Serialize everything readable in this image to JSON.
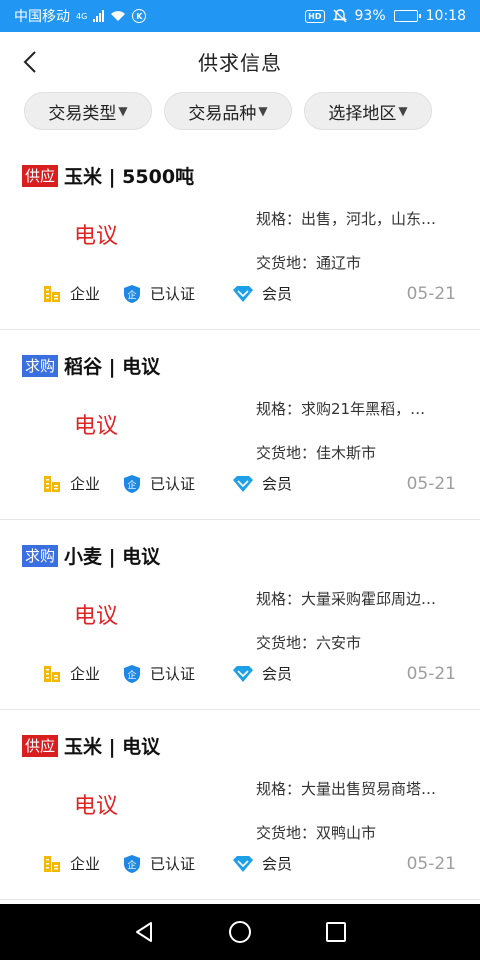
{
  "status_bar": {
    "carrier": "中国移动",
    "network": "4G",
    "battery": "93%",
    "battery_level": 0.93,
    "time": "10:18",
    "hd_label": "HD",
    "k_label": "K"
  },
  "header": {
    "title": "供求信息"
  },
  "filters": [
    {
      "label": "交易类型"
    },
    {
      "label": "交易品种"
    },
    {
      "label": "选择地区"
    }
  ],
  "colors": {
    "status_bar": "#2196f3",
    "supply_tag": "#d81e1e",
    "demand_tag": "#3a6fe0",
    "price": "#e02424",
    "company_icon": "#f5b800",
    "certified_icon": "#1e88e5",
    "member_icon": "#1ea0e8"
  },
  "listings": [
    {
      "tag": "供应",
      "tag_type": "supply",
      "title": "玉米 | 5500吨",
      "price": "电议",
      "spec": "规格：出售，河北，山东…",
      "location": "交货地：通辽市",
      "badges": [
        "企业",
        "已认证",
        "会员"
      ],
      "date": "05-21"
    },
    {
      "tag": "求购",
      "tag_type": "demand",
      "title": "稻谷 | 电议",
      "price": "电议",
      "spec": "规格：求购21年黑稻，…",
      "location": "交货地：佳木斯市",
      "badges": [
        "企业",
        "已认证",
        "会员"
      ],
      "date": "05-21"
    },
    {
      "tag": "求购",
      "tag_type": "demand",
      "title": "小麦 | 电议",
      "price": "电议",
      "spec": "规格：大量采购霍邱周边…",
      "location": "交货地：六安市",
      "badges": [
        "企业",
        "已认证",
        "会员"
      ],
      "date": "05-21"
    },
    {
      "tag": "供应",
      "tag_type": "supply",
      "title": "玉米 | 电议",
      "price": "电议",
      "spec": "规格：大量出售贸易商塔…",
      "location": "交货地：双鸭山市",
      "badges": [
        "企业",
        "已认证",
        "会员"
      ],
      "date": "05-21"
    }
  ],
  "icons": {
    "back": "chevron-left-icon",
    "company": "building-icon",
    "certified": "shield-icon",
    "member": "diamond-icon",
    "nav_back": "triangle-back-icon",
    "nav_home": "circle-home-icon",
    "nav_recent": "square-recent-icon"
  }
}
